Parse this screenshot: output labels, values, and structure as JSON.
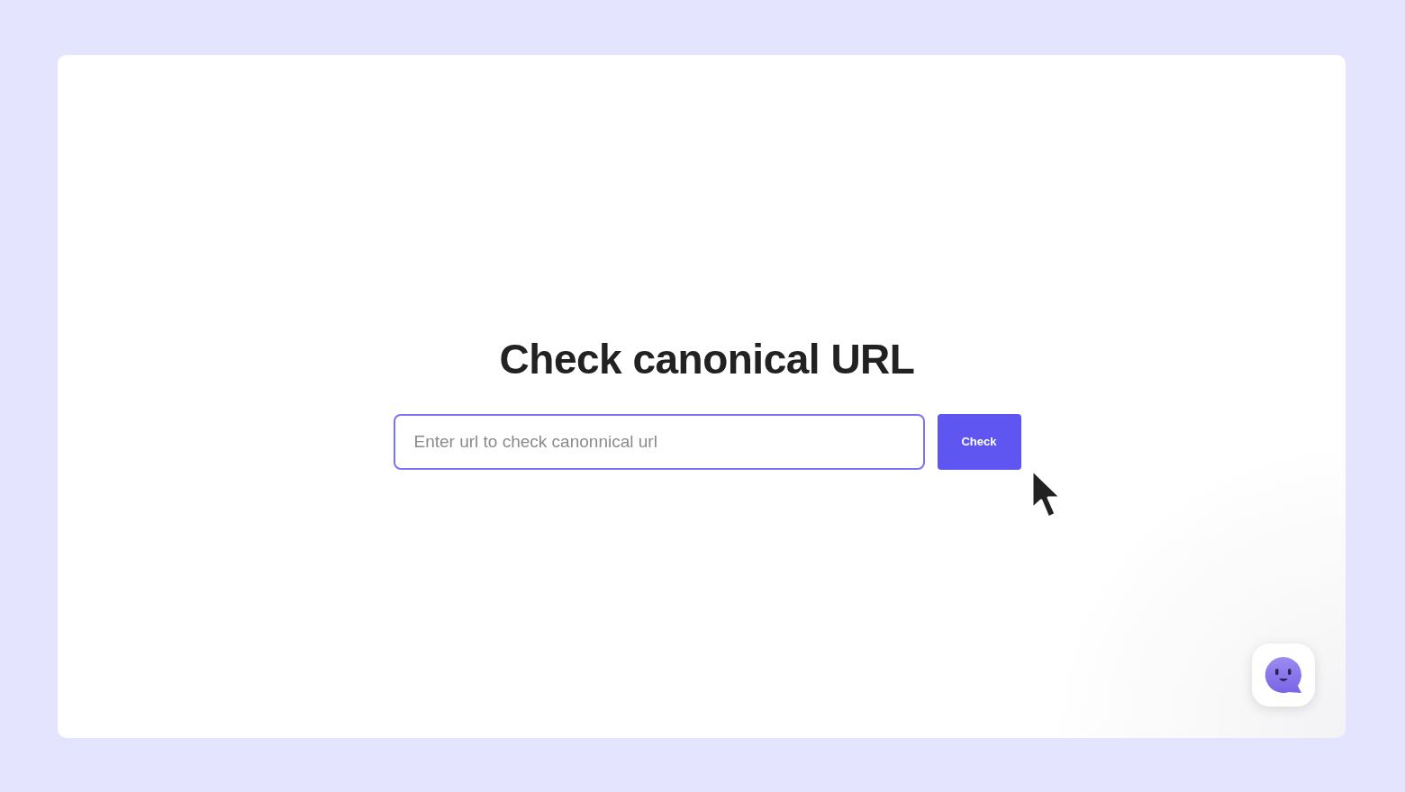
{
  "title": "Check canonical URL",
  "url_field": {
    "placeholder": "Enter url to check canonnical url"
  },
  "check_button": {
    "label": "Check"
  }
}
